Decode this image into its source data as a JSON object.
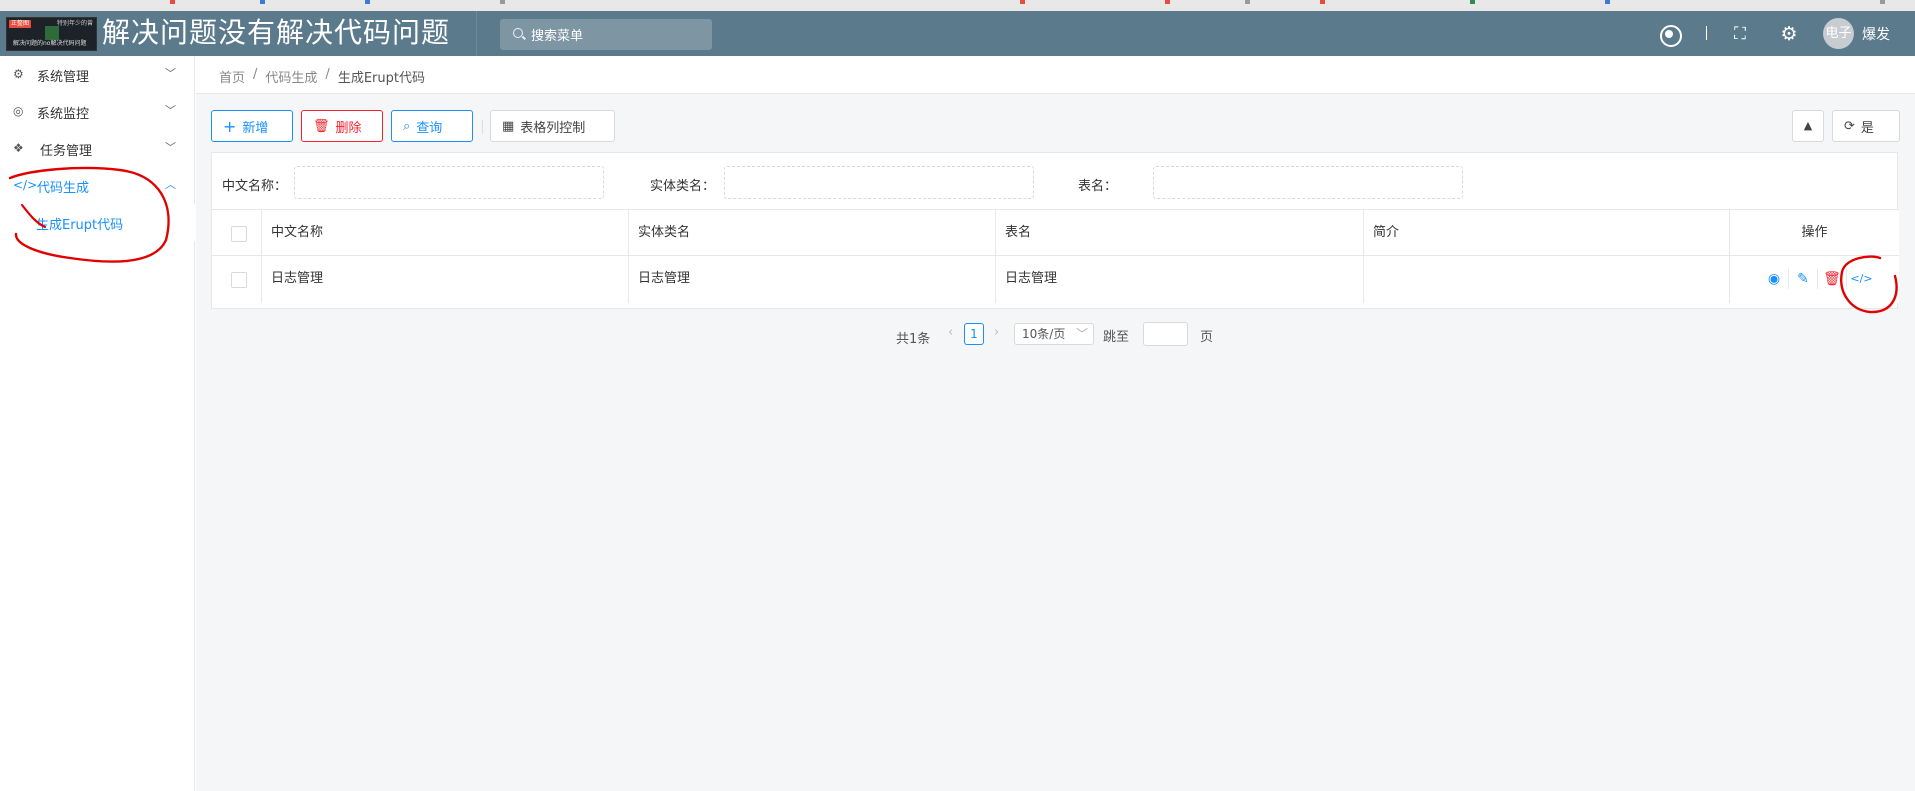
{
  "header": {
    "logo_thumb": {
      "tag": "正整图",
      "corner": "特别年少的曾",
      "caption": "解决问题的no解决代码问题"
    },
    "title": "解决问题没有解决代码问题",
    "search_placeholder": "搜索菜单",
    "user_avatar_text": "电子",
    "user_name": "爆发",
    "bg_color": "#5b7a8c"
  },
  "sidebar": {
    "items": [
      {
        "label": "系统管理",
        "icon": "gears-icon"
      },
      {
        "label": "系统监控",
        "icon": "target-icon"
      },
      {
        "label": "任务管理",
        "icon": "cubes-icon"
      },
      {
        "label": "代码生成",
        "icon": "code-icon"
      }
    ],
    "submenu": {
      "label": "生成Erupt代码"
    },
    "accent_color": "#1890ff"
  },
  "breadcrumb": {
    "items": [
      "首页",
      "代码生成",
      "生成Erupt代码"
    ],
    "sep": "/"
  },
  "toolbar": {
    "add": "新增",
    "delete": "删除",
    "query": "查询",
    "columns": "表格列控制",
    "refresh": "是"
  },
  "filter": {
    "labels": [
      "中文名称：",
      "实体类名：",
      "表名："
    ]
  },
  "table": {
    "headers": [
      "中文名称",
      "实体类名",
      "表名",
      "简介",
      "操作"
    ],
    "rows": [
      {
        "cells": [
          "日志管理",
          "日志管理",
          "日志管理",
          ""
        ]
      }
    ]
  },
  "pager": {
    "total": "共1条",
    "current_page": "1",
    "page_size": "10条/页",
    "jump_label": "跳至",
    "page_suffix": "页"
  }
}
